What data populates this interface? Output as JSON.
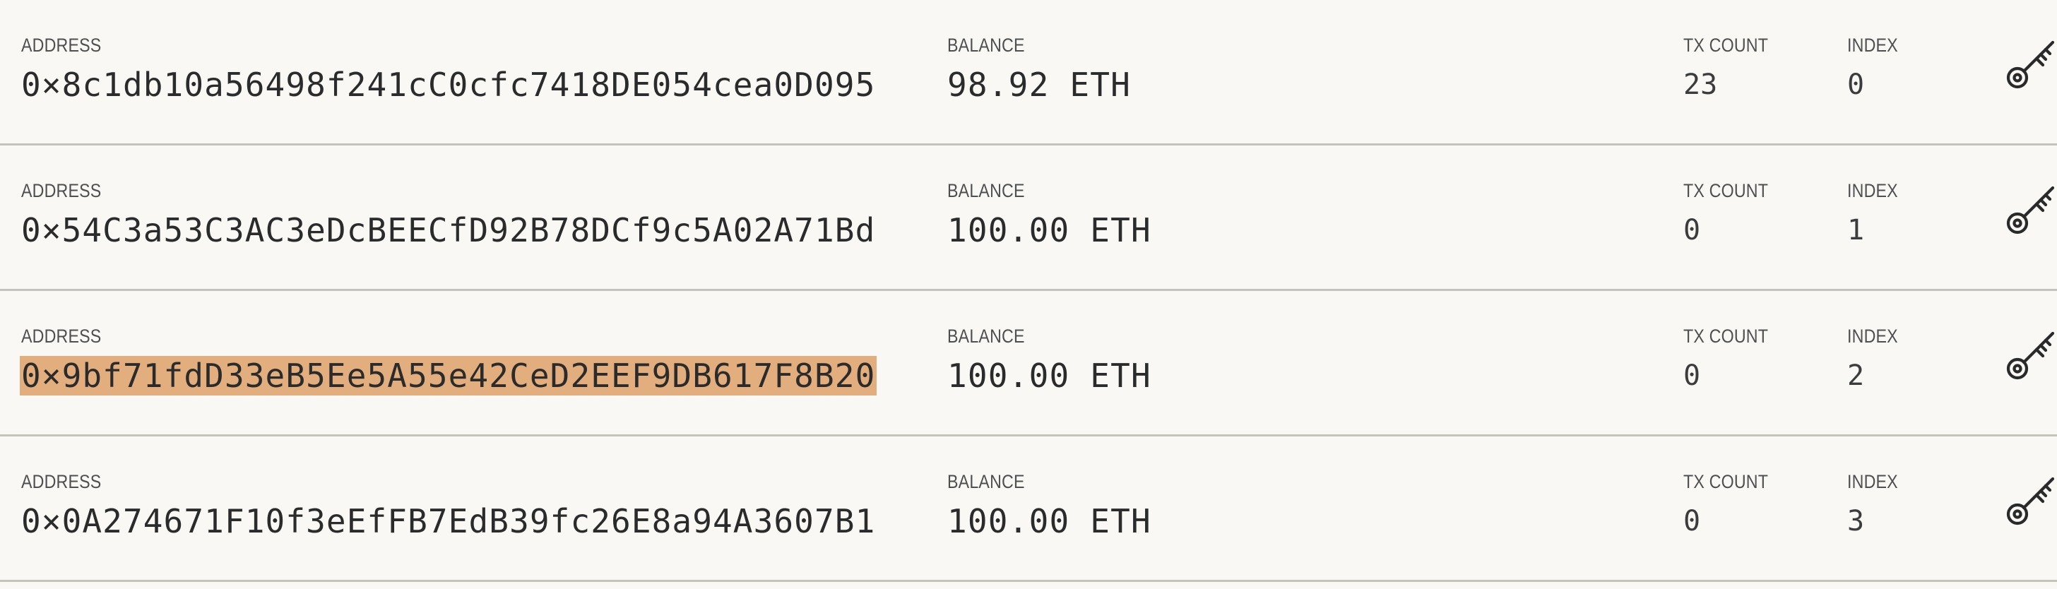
{
  "labels": {
    "address": "ADDRESS",
    "balance": "BALANCE",
    "tx_count": "TX COUNT",
    "index": "INDEX"
  },
  "accounts": [
    {
      "address": "0×8c1db10a56498f241cC0cfc7418DE054cea0D095",
      "balance": "98.92 ETH",
      "tx_count": "23",
      "index": "0",
      "selected": false
    },
    {
      "address": "0×54C3a53C3AC3eDcBEECfD92B78DCf9c5A02A71Bd",
      "balance": "100.00 ETH",
      "tx_count": "0",
      "index": "1",
      "selected": false
    },
    {
      "address": "0×9bf71fdD33eB5Ee5A55e42CeD2EEF9DB617F8B20",
      "balance": "100.00 ETH",
      "tx_count": "0",
      "index": "2",
      "selected": true
    },
    {
      "address": "0×0A274671F10f3eEfFB7EdB39fc26E8a94A3607B1",
      "balance": "100.00 ETH",
      "tx_count": "0",
      "index": "3",
      "selected": false
    }
  ],
  "icons": {
    "key": "key-icon"
  },
  "colors": {
    "background": "#f9f8f4",
    "selection_highlight": "#e2ae7d",
    "divider": "#c4c2bc"
  }
}
